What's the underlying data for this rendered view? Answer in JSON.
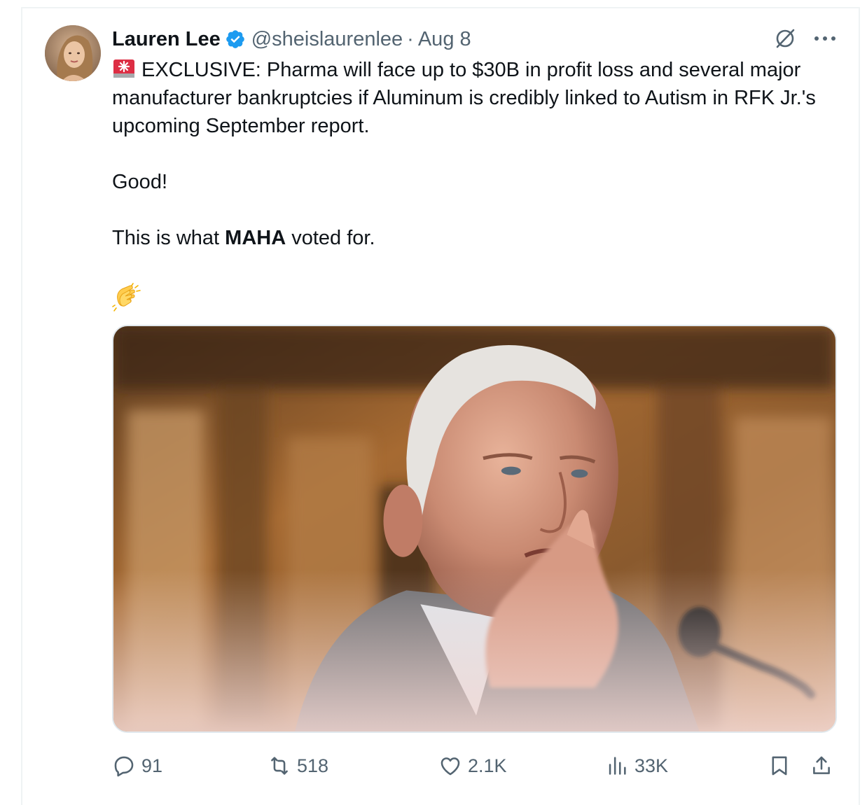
{
  "tweet": {
    "author_name": "Lauren Lee",
    "author_handle": "@sheislaurenlee",
    "separator": "·",
    "date": "Aug 8",
    "text_line1": "EXCLUSIVE: Pharma will face up to $30B in profit loss and several major manufacturer bankruptcies if Aluminum is credibly linked to Autism in RFK Jr.'s upcoming September report.",
    "text_good": "Good!",
    "text_maha_before": "This is what ",
    "text_maha_bold": "MAHA",
    "text_maha_after": " voted for.",
    "icons": {
      "verified": "verified-badge-icon",
      "grok": "grok-icon",
      "more": "more-icon",
      "siren": "siren-emoji",
      "clap": "clapping-hands-emoji"
    }
  },
  "actions": {
    "replies": "91",
    "reposts": "518",
    "likes": "2.1K",
    "views": "33K"
  },
  "colors": {
    "text": "#0f1419",
    "secondary": "#536471",
    "verified": "#1d9bf0",
    "border": "#eff3f4"
  }
}
